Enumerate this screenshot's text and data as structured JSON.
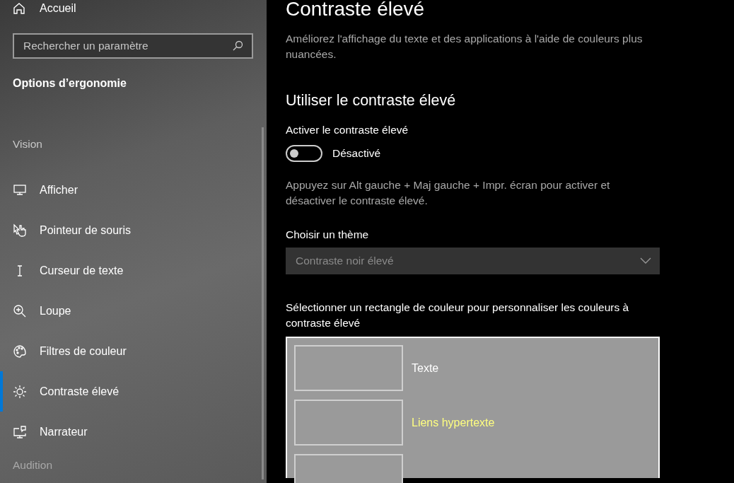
{
  "sidebar": {
    "home": {
      "label": "Accueil"
    },
    "search": {
      "placeholder": "Rechercher un paramètre"
    },
    "section_title": "Options d’ergonomie",
    "group_label": "Vision",
    "items": [
      {
        "label": "Afficher",
        "selected": false
      },
      {
        "label": "Pointeur de souris",
        "selected": false
      },
      {
        "label": "Curseur de texte",
        "selected": false
      },
      {
        "label": "Loupe",
        "selected": false
      },
      {
        "label": "Filtres de couleur",
        "selected": false
      },
      {
        "label": "Contraste élevé",
        "selected": true
      },
      {
        "label": "Narrateur",
        "selected": false
      }
    ],
    "next_group_label": "Audition"
  },
  "main": {
    "title": "Contraste élevé",
    "description": "Améliorez l'affichage du texte et des applications à l'aide de couleurs plus nuancées.",
    "section_title": "Utiliser le contraste élevé",
    "toggle": {
      "label": "Activer le contraste élevé",
      "on": false,
      "state_text": "Désactivé"
    },
    "hint": "Appuyez sur Alt gauche + Maj gauche + Impr. écran pour activer et désactiver le contraste élevé.",
    "theme": {
      "label": "Choisir un thème",
      "value": "Contraste noir élevé",
      "disabled": true
    },
    "swatch_intro": "Sélectionner un rectangle de couleur pour personnaliser les couleurs à contraste élevé",
    "swatches": [
      {
        "label": "Texte",
        "color": "#ffffff"
      },
      {
        "label": "Liens hypertexte",
        "color": "#ffff80"
      }
    ]
  }
}
